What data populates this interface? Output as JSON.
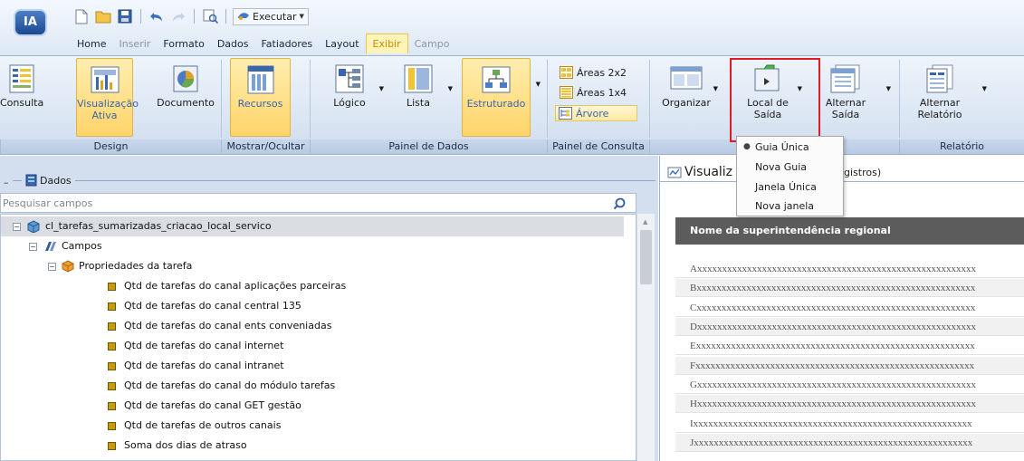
{
  "app": {
    "logo_text": "IA"
  },
  "quick_access": {
    "execute_label": "Executar"
  },
  "tabs": [
    {
      "label": "Home"
    },
    {
      "label": "Inserir"
    },
    {
      "label": "Formato"
    },
    {
      "label": "Dados"
    },
    {
      "label": "Fatiadores"
    },
    {
      "label": "Layout"
    },
    {
      "label": "Exibir"
    },
    {
      "label": "Campo"
    }
  ],
  "ribbon": {
    "groups": {
      "design": "Design",
      "mostrar": "Mostrar/Ocultar",
      "painel_dados": "Painel de Dados",
      "painel_consulta": "Painel de Consulta",
      "relatorio": "Relatório"
    },
    "buttons": {
      "consulta": "Consulta",
      "visualizacao_1": "Visualização",
      "visualizacao_2": "Ativa",
      "documento": "Documento",
      "recursos": "Recursos",
      "logico": "Lógico",
      "lista": "Lista",
      "estruturado": "Estruturado",
      "areas2x2": "Áreas 2x2",
      "areas1x4": "Áreas 1x4",
      "arvore": "Árvore",
      "organizar": "Organizar",
      "local_1": "Local de",
      "local_2": "Saída",
      "alternar_saida_1": "Alternar",
      "alternar_saida_2": "Saída",
      "alternar_rel_1": "Alternar",
      "alternar_rel_2": "Relatório"
    }
  },
  "menu": {
    "items": [
      "Guia Única",
      "Nova Guia",
      "Janela Única",
      "Nova janela"
    ]
  },
  "data_panel": {
    "title": "Dados",
    "search_placeholder": "Pesquisar campos",
    "root": "cl_tarefas_sumarizadas_criacao_local_servico",
    "campos": "Campos",
    "propriedades": "Propriedades da tarefa",
    "fields": [
      "Qtd de tarefas do canal aplicações parceiras",
      "Qtd de tarefas do canal central 135",
      "Qtd de tarefas do canal ents conveniadas",
      "Qtd de tarefas do canal internet",
      "Qtd de tarefas do canal intranet",
      "Qtd de tarefas do canal do módulo tarefas",
      "Qtd de tarefas do canal GET gestão",
      "Qtd de tarefas de outros canais",
      "Soma dos dias de atraso"
    ]
  },
  "view_panel": {
    "title": "Visualiz",
    "subtitle": "gistros)",
    "column_header": "Nome da superintendência regional",
    "rows": [
      "Axxxxxxxxxxxxxxxxxxxxxxxxxxxxxxxxxxxxxxxxxxxxxxxxxxxxxxxx",
      "Bxxxxxxxxxxxxxxxxxxxxxxxxxxxxxxxxxxxxxxxxxxxxxxxxxxxxxxxx",
      "Cxxxxxxxxxxxxxxxxxxxxxxxxxxxxxxxxxxxxxxxxxxxxxxxxxxxxxxxx",
      "Dxxxxxxxxxxxxxxxxxxxxxxxxxxxxxxxxxxxxxxxxxxxxxxxxxxxxxxxx",
      "Exxxxxxxxxxxxxxxxxxxxxxxxxxxxxxxxxxxxxxxxxxxxxxxxxxxxxxxx",
      "Fxxxxxxxxxxxxxxxxxxxxxxxxxxxxxxxxxxxxxxxxxxxxxxxxxxxxxxxx",
      "Gxxxxxxxxxxxxxxxxxxxxxxxxxxxxxxxxxxxxxxxxxxxxxxxxxxxxxxxx",
      "Hxxxxxxxxxxxxxxxxxxxxxxxxxxxxxxxxxxxxxxxxxxxxxxxxxxxxxxxx",
      "Ixxxxxxxxxxxxxxxxxxxxxxxxxxxxxxxxxxxxxxxxxxxxxxxxxxxxxxxx",
      "Jxxxxxxxxxxxxxxxxxxxxxxxxxxxxxxxxxxxxxxxxxxxxxxxxxxxxxxxx"
    ]
  }
}
